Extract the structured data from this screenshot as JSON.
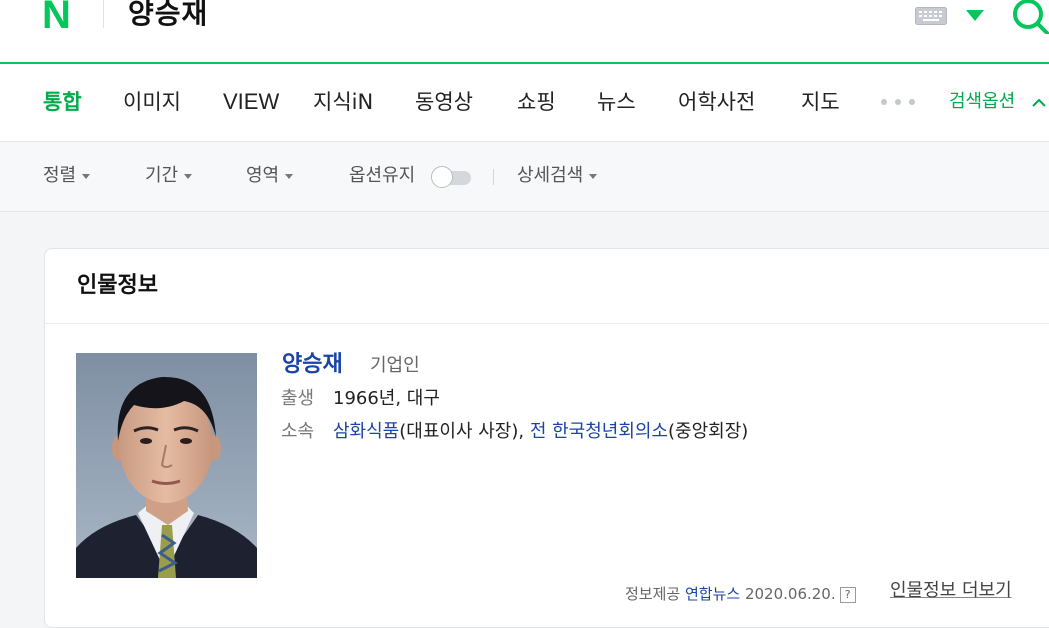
{
  "header": {
    "logo_text": "N",
    "query": "양승재",
    "brand_color": "#03c75a"
  },
  "tabs": [
    {
      "label": "통합",
      "active": true
    },
    {
      "label": "이미지",
      "active": false
    },
    {
      "label": "VIEW",
      "active": false
    },
    {
      "label": "지식iN",
      "active": false
    },
    {
      "label": "동영상",
      "active": false
    },
    {
      "label": "쇼핑",
      "active": false
    },
    {
      "label": "뉴스",
      "active": false
    },
    {
      "label": "어학사전",
      "active": false
    },
    {
      "label": "지도",
      "active": false
    }
  ],
  "search_options_label": "검색옵션",
  "options": {
    "sort": "정렬",
    "period": "기간",
    "area": "영역",
    "keep_options": "옵션유지",
    "keep_options_on": false,
    "advanced": "상세검색"
  },
  "card": {
    "title": "인물정보",
    "name": "양승재",
    "occupation": "기업인",
    "birth_label": "출생",
    "birth_value": "1966년, 대구",
    "affiliation_label": "소속",
    "affiliation_company": "삼화식품",
    "affiliation_role1": "(대표이사 사장), ",
    "affiliation_org": "전 한국청년회의소",
    "affiliation_role2": "(중앙회장)",
    "source_label": "정보제공",
    "source_name": "연합뉴스",
    "source_date": "2020.06.20.",
    "help_mark": "?",
    "more_link": "인물정보 더보기"
  }
}
